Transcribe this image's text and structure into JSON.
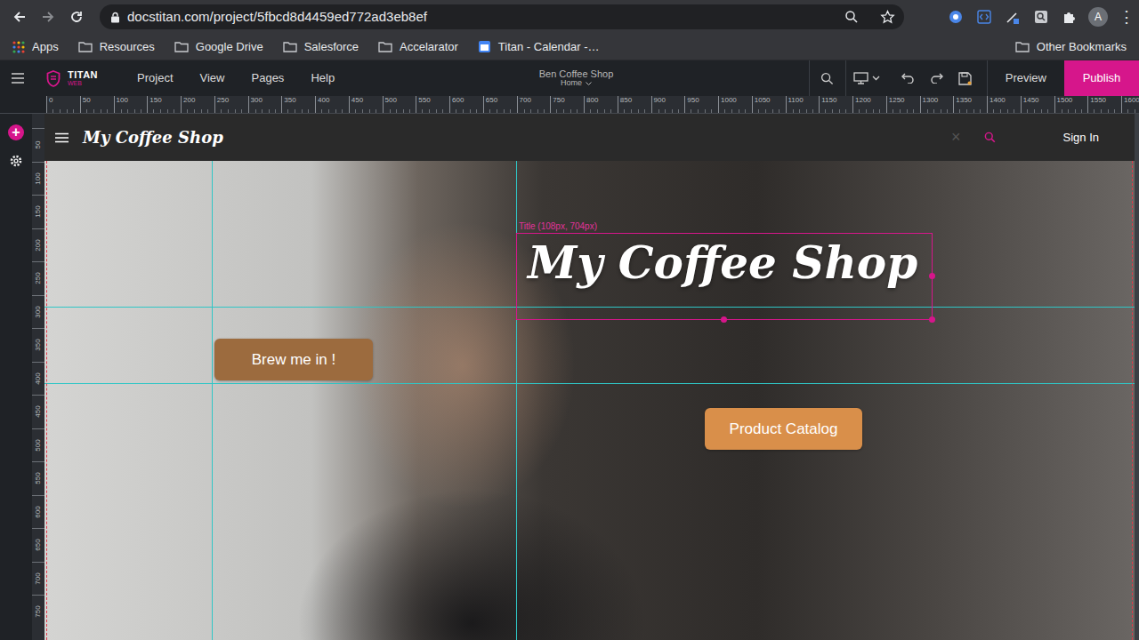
{
  "browser": {
    "url": "docstitan.com/project/5fbcd8d4459ed772ad3eb8ef",
    "avatar": "A",
    "menu": "⋮",
    "bookmarks": [
      {
        "label": "Apps",
        "kind": "apps"
      },
      {
        "label": "Resources",
        "kind": "folder"
      },
      {
        "label": "Google Drive",
        "kind": "folder"
      },
      {
        "label": "Salesforce",
        "kind": "folder"
      },
      {
        "label": "Accelarator",
        "kind": "folder"
      },
      {
        "label": "Titan - Calendar -…",
        "kind": "page"
      }
    ],
    "other_bookmarks": "Other Bookmarks"
  },
  "editor": {
    "logo": "TITAN",
    "logo_sub": "WEB",
    "menu": [
      "Project",
      "View",
      "Pages",
      "Help"
    ],
    "project": "Ben Coffee Shop",
    "page": "Home",
    "preview": "Preview",
    "publish": "Publish",
    "add_button": "+"
  },
  "rulers": {
    "horizontal": [
      "0",
      "50",
      "100",
      "150",
      "200",
      "250",
      "300",
      "350",
      "400",
      "450",
      "500",
      "550",
      "600",
      "650",
      "700",
      "750",
      "800",
      "850",
      "900",
      "950",
      "1000",
      "1050",
      "1100",
      "1150",
      "1200",
      "1250",
      "1300",
      "1350",
      "1400",
      "1450",
      "1500",
      "1550",
      "1600"
    ],
    "vertical": [
      "50",
      "100",
      "150",
      "200",
      "250",
      "300",
      "350",
      "400",
      "450",
      "500",
      "550",
      "600",
      "650",
      "700",
      "750"
    ]
  },
  "site": {
    "brand": "My Coffee Shop",
    "close": "×",
    "sign_in": "Sign In"
  },
  "hero": {
    "title": {
      "text": "My Coffee Shop",
      "selected": true,
      "selection_label": "Title (108px, 704px)"
    },
    "buttons": [
      {
        "label": "Brew me in !",
        "color": "#9c6b3e"
      },
      {
        "label": "Product Catalog",
        "color": "#d98f4a"
      }
    ]
  }
}
